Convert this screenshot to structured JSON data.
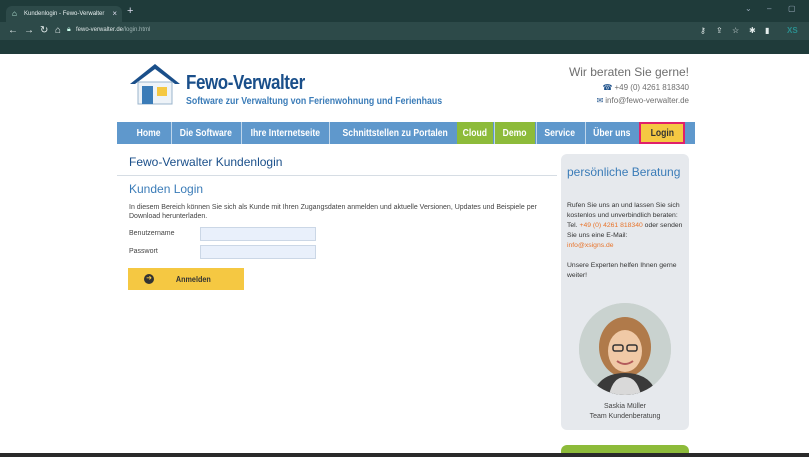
{
  "browser": {
    "tab_title": "Kundenlogin - Fewo-Verwalter",
    "url_domain": "fewo-verwalter.de",
    "url_path": "/login.html",
    "profile_label": "XS"
  },
  "header": {
    "brand": "Fewo-Verwalter",
    "tagline": "Software zur Verwaltung von Ferienwohnung und Ferienhaus",
    "contact_heading": "Wir beraten Sie gerne!",
    "phone": "+49 (0) 4261 818340",
    "email": "info@fewo-verwalter.de"
  },
  "nav": {
    "items": [
      {
        "label": "Home"
      },
      {
        "label": "Die Software"
      },
      {
        "label": "Ihre Internetseite"
      },
      {
        "label": "Schnittstellen zu Portalen"
      },
      {
        "label": "Cloud"
      },
      {
        "label": "Demo"
      },
      {
        "label": "Service"
      },
      {
        "label": "Über uns"
      },
      {
        "label": "Login"
      }
    ]
  },
  "main": {
    "page_title": "Fewo-Verwalter Kundenlogin",
    "section_title": "Kunden Login",
    "intro": "In diesem Bereich können Sie sich als Kunde mit Ihren Zugangsdaten anmelden und aktuelle Versionen, Updates und Beispiele per Download herunterladen.",
    "username_label": "Benutzername",
    "password_label": "Passwort",
    "login_button": "Anmelden"
  },
  "sidebar": {
    "heading": "persönliche Beratung",
    "text1": "Rufen Sie uns an und lassen Sie sich kostenlos und unverbindlich beraten:",
    "tel_prefix": "Tel.",
    "phone": "+49 (0) 4261 818340",
    "text2": "oder senden Sie uns eine E-Mail:",
    "email": "info@xsigns.de",
    "text3": "Unsere Experten helfen Ihnen gerne weiter!",
    "person_name": "Saskia Müller",
    "person_role": "Team Kundenberatung"
  },
  "colors": {
    "nav_blue": "#5f98cc",
    "nav_green": "#8dbb3a",
    "login_yellow": "#f5c842",
    "highlight_pink": "#e0206a",
    "brand_blue": "#1a4f8a",
    "link_orange": "#e8742b"
  }
}
